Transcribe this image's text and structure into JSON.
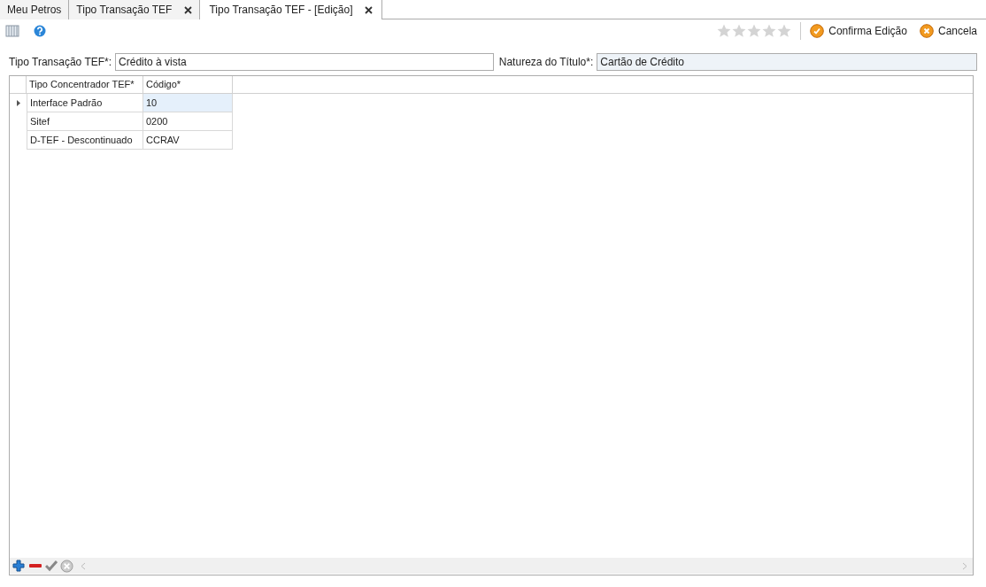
{
  "tabs": [
    {
      "label": "Meu Petros",
      "selected": false,
      "closable": false
    },
    {
      "label": "Tipo Transação TEF",
      "selected": false,
      "closable": true
    },
    {
      "label": "Tipo Transação TEF - [Edição]",
      "selected": true,
      "closable": true
    }
  ],
  "toolbar": {
    "rating": {
      "stars": 0
    },
    "actions": [
      {
        "label": "Confirma Edição",
        "kind": "confirm"
      },
      {
        "label": "Cancela",
        "kind": "cancel"
      }
    ]
  },
  "fields": [
    {
      "label": "Tipo Transação TEF*:",
      "value": "Crédito à vista",
      "disabled": false
    },
    {
      "label": "Natureza do Título*:",
      "value": "Cartão de Crédito",
      "disabled": true
    }
  ],
  "grid": {
    "columns": [
      "Tipo Concentrador TEF*",
      "Código*"
    ],
    "rows": [
      {
        "cells": [
          "Interface Padrão",
          "10"
        ],
        "selected": true
      },
      {
        "cells": [
          "Sitef",
          "0200"
        ],
        "selected": false
      },
      {
        "cells": [
          "D-TEF - Descontinuado",
          "CCRAV"
        ],
        "selected": false
      }
    ]
  }
}
